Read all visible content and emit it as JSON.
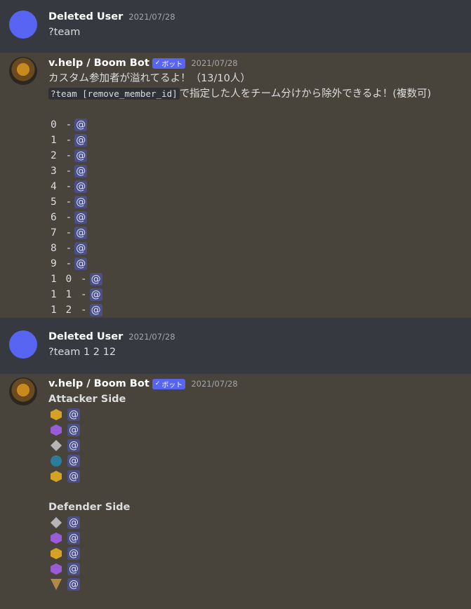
{
  "messages": [
    {
      "author": "Deleted User",
      "timestamp": "2021/07/28",
      "text": "?team"
    },
    {
      "author": "v.help / Boom Bot",
      "bot_tag": "ボット",
      "bot_tag_check": "✓",
      "timestamp": "2021/07/28",
      "line1": "カスタム参加者が溢れてるよ！（13/10人）",
      "code": "?team [remove_member_id]",
      "line2_suffix": "で指定した人をチーム分けから除外できるよ！(複数可)",
      "list": [
        "0 -",
        "1 -",
        "2 -",
        "3 -",
        "4 -",
        "5 -",
        "6 -",
        "7 -",
        "8 -",
        "9 -",
        "1 0 -",
        "1 1 -",
        "1 2 -"
      ],
      "mention": "@"
    },
    {
      "author": "Deleted User",
      "timestamp": "2021/07/28",
      "text": "?team 1 2 12"
    },
    {
      "author": "v.help / Boom Bot",
      "bot_tag": "ボット",
      "bot_tag_check": "✓",
      "timestamp": "2021/07/28",
      "attacker_title": "Attacker Side",
      "attacker_ranks": [
        "gold",
        "purple",
        "silver",
        "blue",
        "gold"
      ],
      "defender_title": "Defender Side",
      "defender_ranks": [
        "silver",
        "purple",
        "gold",
        "purple",
        "bronze"
      ],
      "mention": "@"
    }
  ]
}
